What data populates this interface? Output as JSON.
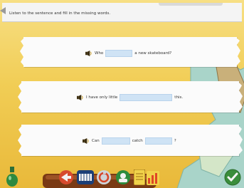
{
  "instructions": "Listen to the sentence and fill in the missing words.",
  "sentences": [
    {
      "before": "Who",
      "after": "a new skateboard?"
    },
    {
      "before": "I have only little",
      "after": "this."
    },
    {
      "before": "Can",
      "middle": "catch",
      "after": "?"
    }
  ],
  "colors": {
    "background": "#f1cd55",
    "blank": "#cfe3f5",
    "card": "#fbfbfb"
  }
}
